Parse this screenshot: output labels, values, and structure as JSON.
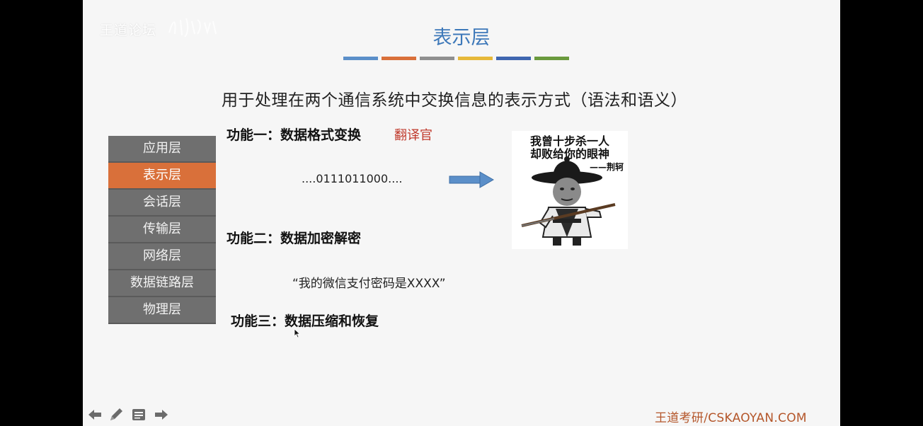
{
  "watermark": {
    "text": "王道论坛"
  },
  "slide": {
    "title": "表示层",
    "stripe_colors": [
      "#5b8fc9",
      "#d9703a",
      "#8f8f8f",
      "#e6b839",
      "#3f66b0",
      "#6a9a3d"
    ],
    "subtitle": "用于处理在两个通信系统中交换信息的表示方式（语法和语义）"
  },
  "layers": [
    {
      "label": "应用层",
      "active": false
    },
    {
      "label": "表示层",
      "active": true
    },
    {
      "label": "会话层",
      "active": false
    },
    {
      "label": "传输层",
      "active": false
    },
    {
      "label": "网络层",
      "active": false
    },
    {
      "label": "数据链路层",
      "active": false
    },
    {
      "label": "物理层",
      "active": false
    }
  ],
  "functions": {
    "f1": "功能一：数据格式变换",
    "f1_note": "翻译官",
    "bits": "....0111011000....",
    "f2": "功能二：数据加密解密",
    "f2_example": "“我的微信支付密码是XXXX”",
    "f3": "功能三：数据压缩和恢复"
  },
  "meme": {
    "line1": "我曾十步杀一人",
    "line2": "却败给你的眼神",
    "signature": "——荆轲"
  },
  "footer": {
    "text": "王道考研/CSKAOYAN.COM"
  },
  "controls": [
    "back-arrow-icon",
    "pen-icon",
    "menu-icon",
    "forward-arrow-icon"
  ],
  "colors": {
    "accent_title": "#3d78b9",
    "active_layer": "#d9703a",
    "layer_bg": "#6f6f6f",
    "note_red": "#c0392b",
    "footer": "#b4562a"
  }
}
